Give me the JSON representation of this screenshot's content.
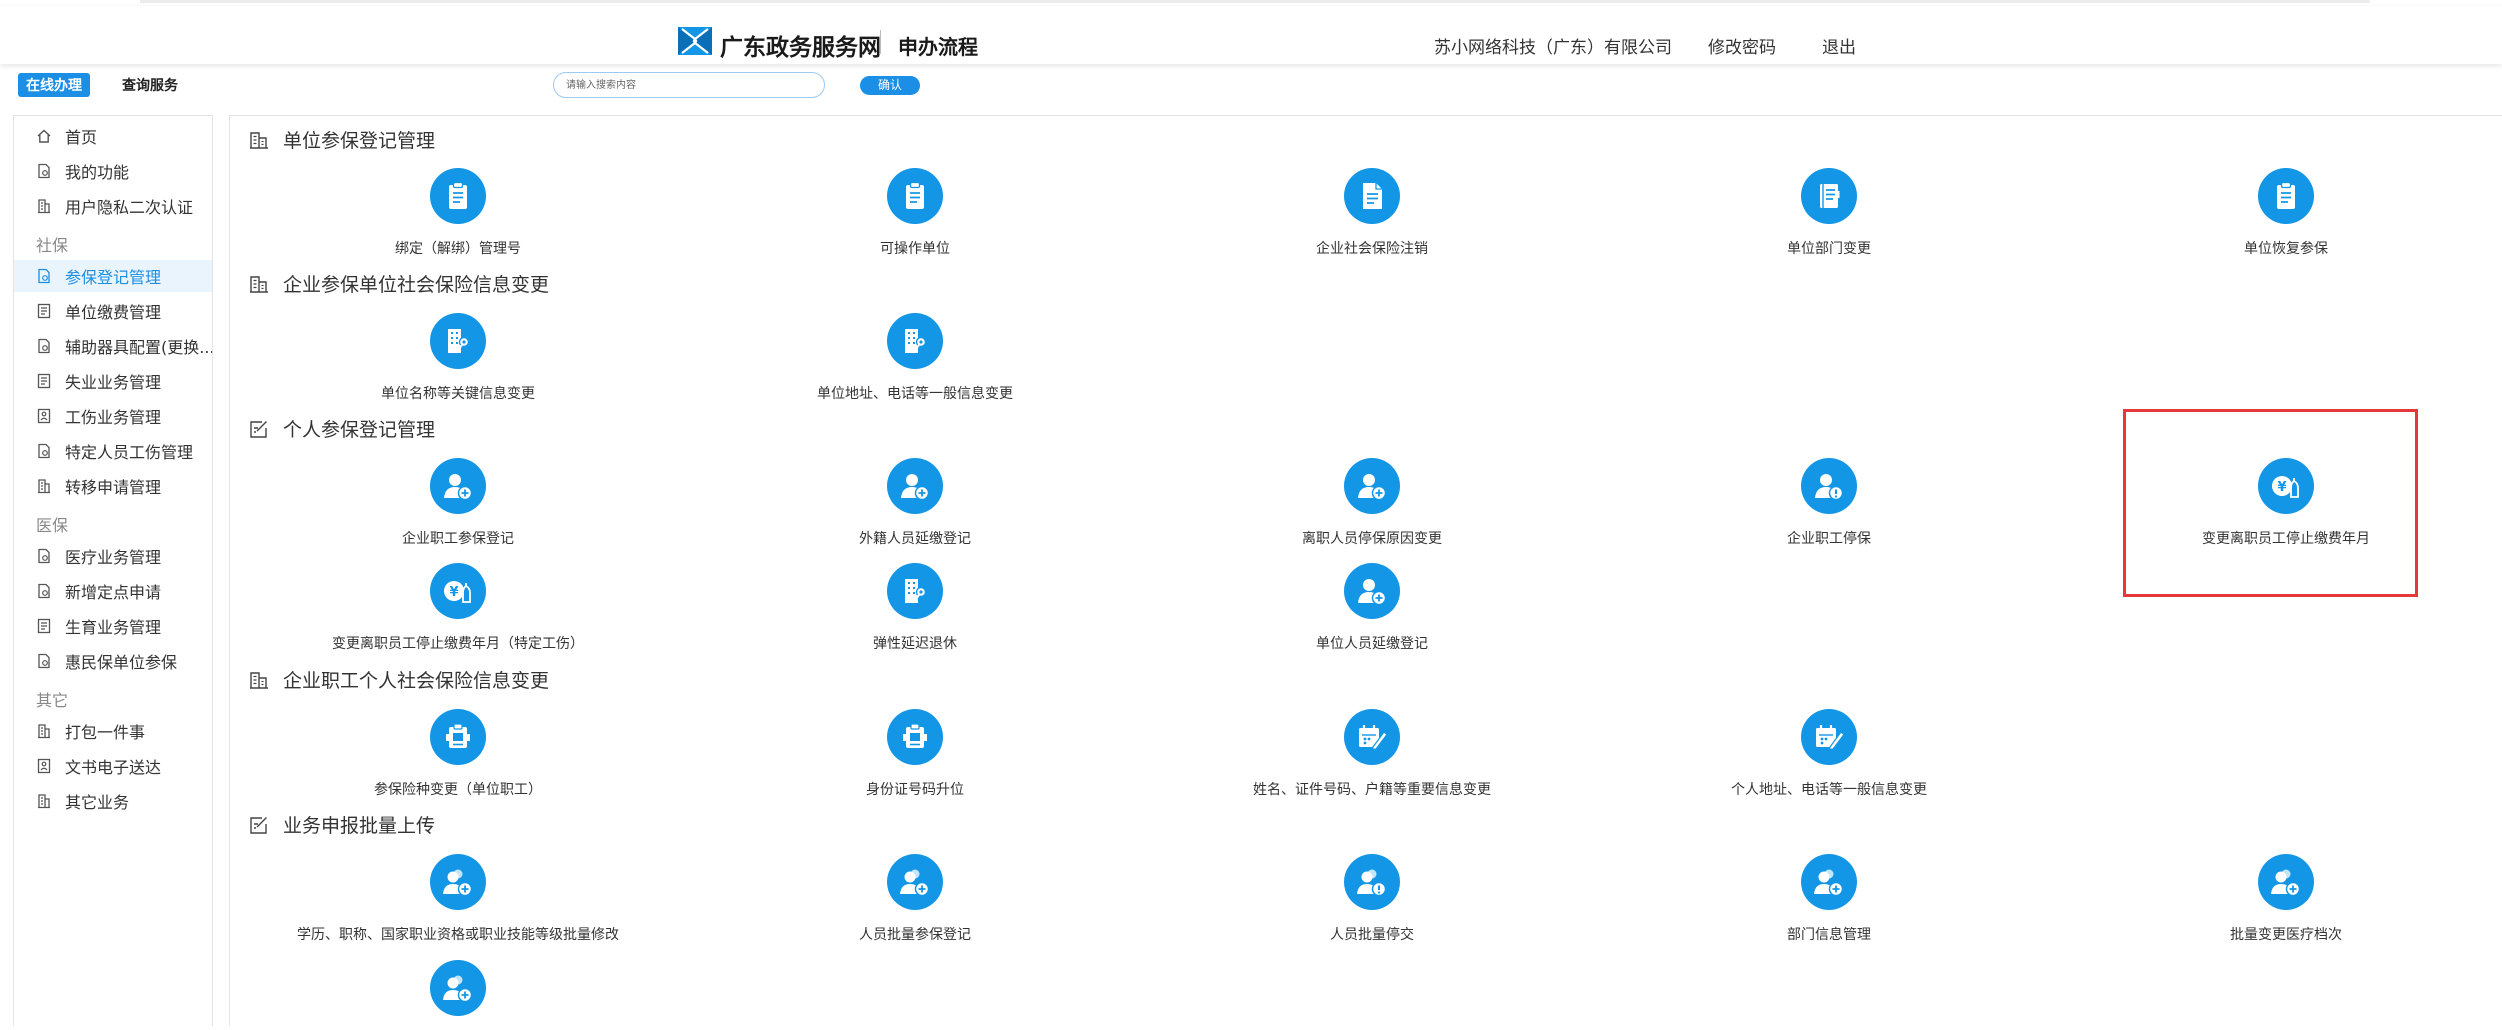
{
  "header": {
    "site_name": "广东政务服务网",
    "sub_title": "申办流程",
    "user": "苏小网络科技（广东）有限公司",
    "change_password": "修改密码",
    "logout": "退出"
  },
  "subbar": {
    "tab_online": "在线办理",
    "tab_query": "查询服务",
    "search_placeholder": "请输入搜索内容",
    "confirm": "确认"
  },
  "sidebar": {
    "items": [
      {
        "label": "首页",
        "icon": "home-icon"
      },
      {
        "label": "我的功能",
        "icon": "doc-icon"
      },
      {
        "label": "用户隐私二次认证",
        "icon": "building-icon"
      },
      {
        "group": "社保"
      },
      {
        "label": "参保登记管理",
        "icon": "doc-icon",
        "active": true
      },
      {
        "label": "单位缴费管理",
        "icon": "list-icon"
      },
      {
        "label": "辅助器具配置(更换...",
        "icon": "doc-icon"
      },
      {
        "label": "失业业务管理",
        "icon": "list-icon"
      },
      {
        "label": "工伤业务管理",
        "icon": "id-card-icon"
      },
      {
        "label": "特定人员工伤管理",
        "icon": "doc-icon"
      },
      {
        "label": "转移申请管理",
        "icon": "building-icon"
      },
      {
        "group": "医保"
      },
      {
        "label": "医疗业务管理",
        "icon": "doc-icon"
      },
      {
        "label": "新增定点申请",
        "icon": "doc-icon"
      },
      {
        "label": "生育业务管理",
        "icon": "list-icon"
      },
      {
        "label": "惠民保单位参保",
        "icon": "doc-icon"
      },
      {
        "group": "其它"
      },
      {
        "label": "打包一件事",
        "icon": "building-icon"
      },
      {
        "label": "文书电子送达",
        "icon": "id-card-icon"
      },
      {
        "label": "其它业务",
        "icon": "building-icon"
      }
    ]
  },
  "sections": [
    {
      "title": "单位参保登记管理",
      "icon": "building-icon",
      "items": [
        {
          "label": "绑定（解绑）管理号",
          "icon": "clipboard-icon"
        },
        {
          "label": "可操作单位",
          "icon": "clipboard-icon"
        },
        {
          "label": "企业社会保险注销",
          "icon": "document-icon"
        },
        {
          "label": "单位部门变更",
          "icon": "notebook-icon"
        },
        {
          "label": "单位恢复参保",
          "icon": "clipboard-icon"
        }
      ]
    },
    {
      "title": "企业参保单位社会保险信息变更",
      "icon": "building-icon",
      "items": [
        {
          "label": "单位名称等关键信息变更",
          "icon": "office-key-icon"
        },
        {
          "label": "单位地址、电话等一般信息变更",
          "icon": "office-key-icon"
        }
      ]
    },
    {
      "title": "个人参保登记管理",
      "icon": "edit-icon",
      "items": [
        {
          "label": "企业职工参保登记",
          "icon": "user-add-icon"
        },
        {
          "label": "外籍人员延缴登记",
          "icon": "user-add-icon"
        },
        {
          "label": "离职人员停保原因变更",
          "icon": "user-add-icon"
        },
        {
          "label": "企业职工停保",
          "icon": "user-alert-icon"
        },
        {
          "label": "变更离职员工停止缴费年月",
          "icon": "yuan-bottle-icon"
        },
        {
          "label": "变更离职员工停止缴费年月（特定工伤）",
          "icon": "yuan-bottle-icon"
        },
        {
          "label": "弹性延迟退休",
          "icon": "office-key-icon"
        },
        {
          "label": "单位人员延缴登记",
          "icon": "user-add-icon"
        }
      ]
    },
    {
      "title": "企业职工个人社会保险信息变更",
      "icon": "building-icon",
      "items": [
        {
          "label": "参保险种变更（单位职工）",
          "icon": "id-badge-icon"
        },
        {
          "label": "身份证号码升位",
          "icon": "id-badge-icon"
        },
        {
          "label": "姓名、证件号码、户籍等重要信息变更",
          "icon": "calendar-edit-icon"
        },
        {
          "label": "个人地址、电话等一般信息变更",
          "icon": "calendar-edit-icon"
        }
      ]
    },
    {
      "title": "业务申报批量上传",
      "icon": "edit-icon",
      "items": [
        {
          "label": "学历、职称、国家职业资格或职业技能等级批量修改",
          "icon": "users-add-icon"
        },
        {
          "label": "人员批量参保登记",
          "icon": "users-add-icon"
        },
        {
          "label": "人员批量停交",
          "icon": "users-alert-icon"
        },
        {
          "label": "部门信息管理",
          "icon": "users-add-icon"
        },
        {
          "label": "批量变更医疗档次",
          "icon": "users-add-icon"
        },
        {
          "label": "",
          "icon": "users-add-icon"
        }
      ]
    }
  ],
  "colors": {
    "accent": "#1396e6",
    "highlight": "#e5383b"
  }
}
